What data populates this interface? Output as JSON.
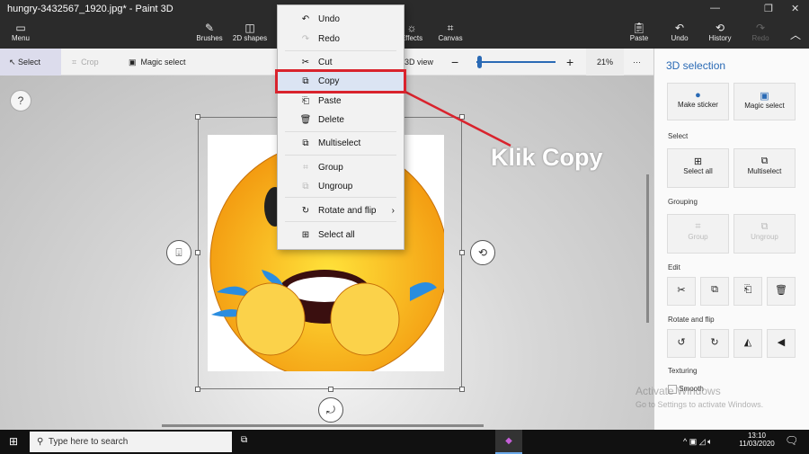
{
  "window": {
    "title": "hungry-3432567_1920.jpg* - Paint 3D"
  },
  "ribbon": {
    "menu": "Menu",
    "brushes": "Brushes",
    "shapes2d": "2D shapes",
    "effects": "Effects",
    "canvas": "Canvas",
    "paste": "Paste",
    "undo": "Undo",
    "history": "History",
    "redo": "Redo"
  },
  "toolbar": {
    "select": "Select",
    "crop": "Crop",
    "magic_select": "Magic select",
    "view3d": "3D view",
    "zoom": "21%",
    "zoom_level_percent": 21,
    "more": "···"
  },
  "help": "?",
  "context_menu": {
    "items": [
      {
        "label": "Undo",
        "icon": "undo-icon"
      },
      {
        "label": "Redo",
        "icon": "redo-icon",
        "disabled": true
      },
      {
        "label": "Cut",
        "icon": "cut-icon"
      },
      {
        "label": "Copy",
        "icon": "copy-icon",
        "highlighted": true
      },
      {
        "label": "Paste",
        "icon": "paste-icon"
      },
      {
        "label": "Delete",
        "icon": "delete-icon"
      },
      {
        "label": "Multiselect",
        "icon": "multiselect-icon"
      },
      {
        "label": "Group",
        "icon": "group-icon",
        "disabled": true
      },
      {
        "label": "Ungroup",
        "icon": "ungroup-icon",
        "disabled": true
      },
      {
        "label": "Rotate and flip",
        "icon": "rotate-icon"
      },
      {
        "label": "Select all",
        "icon": "select-all-icon"
      }
    ]
  },
  "annotation": {
    "text": "Klik Copy",
    "color": "#d9232d"
  },
  "panel": {
    "title": "3D selection",
    "make_sticker": "Make sticker",
    "magic_select": "Magic select",
    "select_section": "Select",
    "select_all": "Select all",
    "multiselect": "Multiselect",
    "grouping_section": "Grouping",
    "group": "Group",
    "ungroup": "Ungroup",
    "edit_section": "Edit",
    "rotate_section": "Rotate and flip",
    "texturing_section": "Texturing",
    "smooth": "Smooth"
  },
  "watermark": {
    "line1": "Activate Windows",
    "line2": "Go to Settings to activate Windows."
  },
  "taskbar": {
    "search_placeholder": "Type here to search",
    "time": "13:10",
    "date": "11/03/2020"
  },
  "colors": {
    "accent": "#2a6ab5",
    "highlight": "#d9232d"
  }
}
